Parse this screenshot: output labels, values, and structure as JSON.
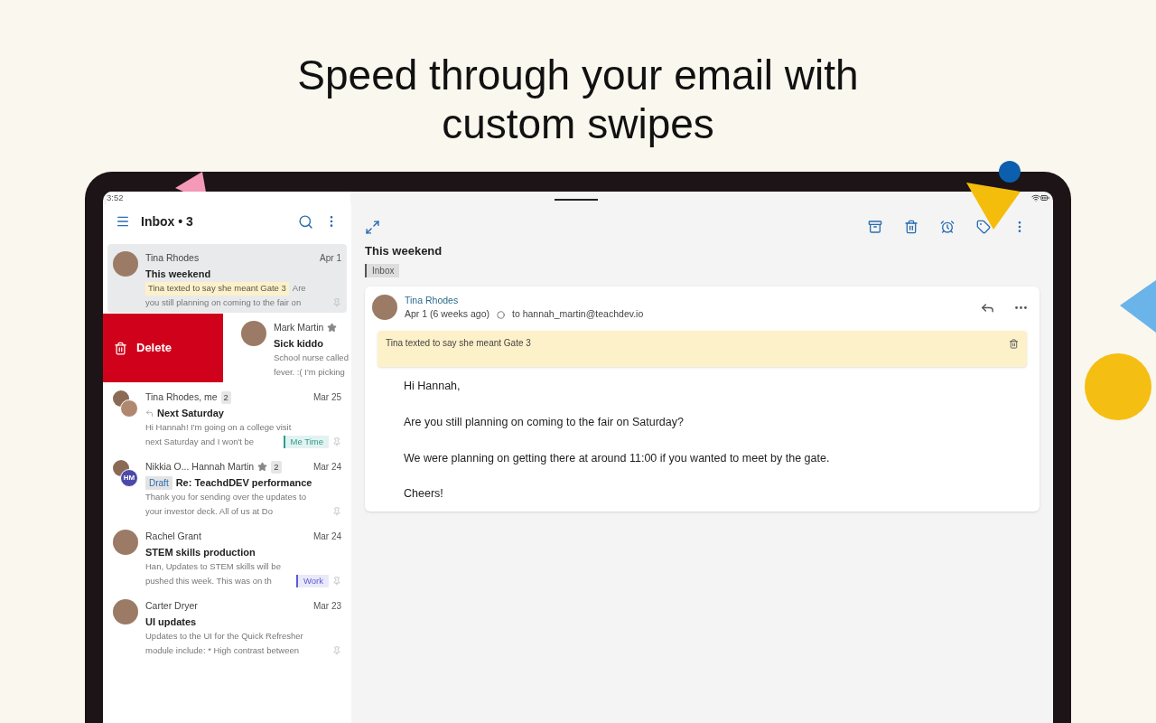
{
  "headline": "Speed through your email with custom swipes",
  "status_bar": {
    "time": "3:52"
  },
  "sidebar": {
    "title": "Inbox • 3"
  },
  "emails": [
    {
      "sender": "Tina Rhodes",
      "date": "Apr 1",
      "subject": "This weekend",
      "note": "Tina texted to say she meant Gate 3",
      "preview": [
        "Are",
        "you still planning on coming to the fair on"
      ],
      "selected": true,
      "starred": false,
      "swiped": false,
      "kind": "single"
    },
    {
      "sender": "Mark Martin",
      "subject": "Sick kiddo",
      "preview": [
        "School nurse called",
        "fever. :( I'm picking"
      ],
      "selected": false,
      "starred": true,
      "swiped": true,
      "swipe_action": "Delete",
      "kind": "single"
    },
    {
      "sender": "Tina Rhodes, me",
      "count": "2",
      "date": "Mar 25",
      "subject": "Next Saturday",
      "replied": true,
      "preview": [
        "Hi Hannah! I'm going on a college visit",
        "next Saturday and I won't be"
      ],
      "tag": {
        "label": "Me Time",
        "color": "#2a9d8f"
      },
      "selected": false,
      "starred": false,
      "swiped": false,
      "kind": "group"
    },
    {
      "sender": "Nikkia O...  Hannah Martin",
      "count": "2",
      "date": "Mar 24",
      "draft": "Draft",
      "initials": "HM",
      "subject": "Re: TeachdDEV performance",
      "preview": [
        "Thank you for sending over the updates to",
        "your investor deck. All of us at Do"
      ],
      "selected": false,
      "starred": true,
      "swiped": false,
      "kind": "group"
    },
    {
      "sender": "Rachel Grant",
      "date": "Mar 24",
      "subject": "STEM skills production",
      "preview": [
        "Han, Updates to STEM skills will be",
        "pushed this week. This was on th"
      ],
      "tag": {
        "label": "Work",
        "color": "#5b5bd6"
      },
      "selected": false,
      "starred": false,
      "swiped": false,
      "kind": "single"
    },
    {
      "sender": "Carter Dryer",
      "date": "Mar 23",
      "subject": "UI updates",
      "preview": [
        "Updates to the UI for the Quick Refresher",
        "module include: * High contrast between"
      ],
      "selected": false,
      "starred": false,
      "swiped": false,
      "kind": "single"
    }
  ],
  "message": {
    "subject": "This weekend",
    "label": "Inbox",
    "sender": "Tina Rhodes",
    "date": "Apr 1 (6 weeks ago)",
    "to": "to hannah_martin@teachdev.io",
    "note": "Tina texted to say she meant Gate 3",
    "body": [
      "Hi Hannah,",
      "Are you still planning on coming to the fair on Saturday?",
      "We were planning on getting there at around 11:00 if you wanted to meet by the gate.",
      "Cheers!"
    ]
  }
}
